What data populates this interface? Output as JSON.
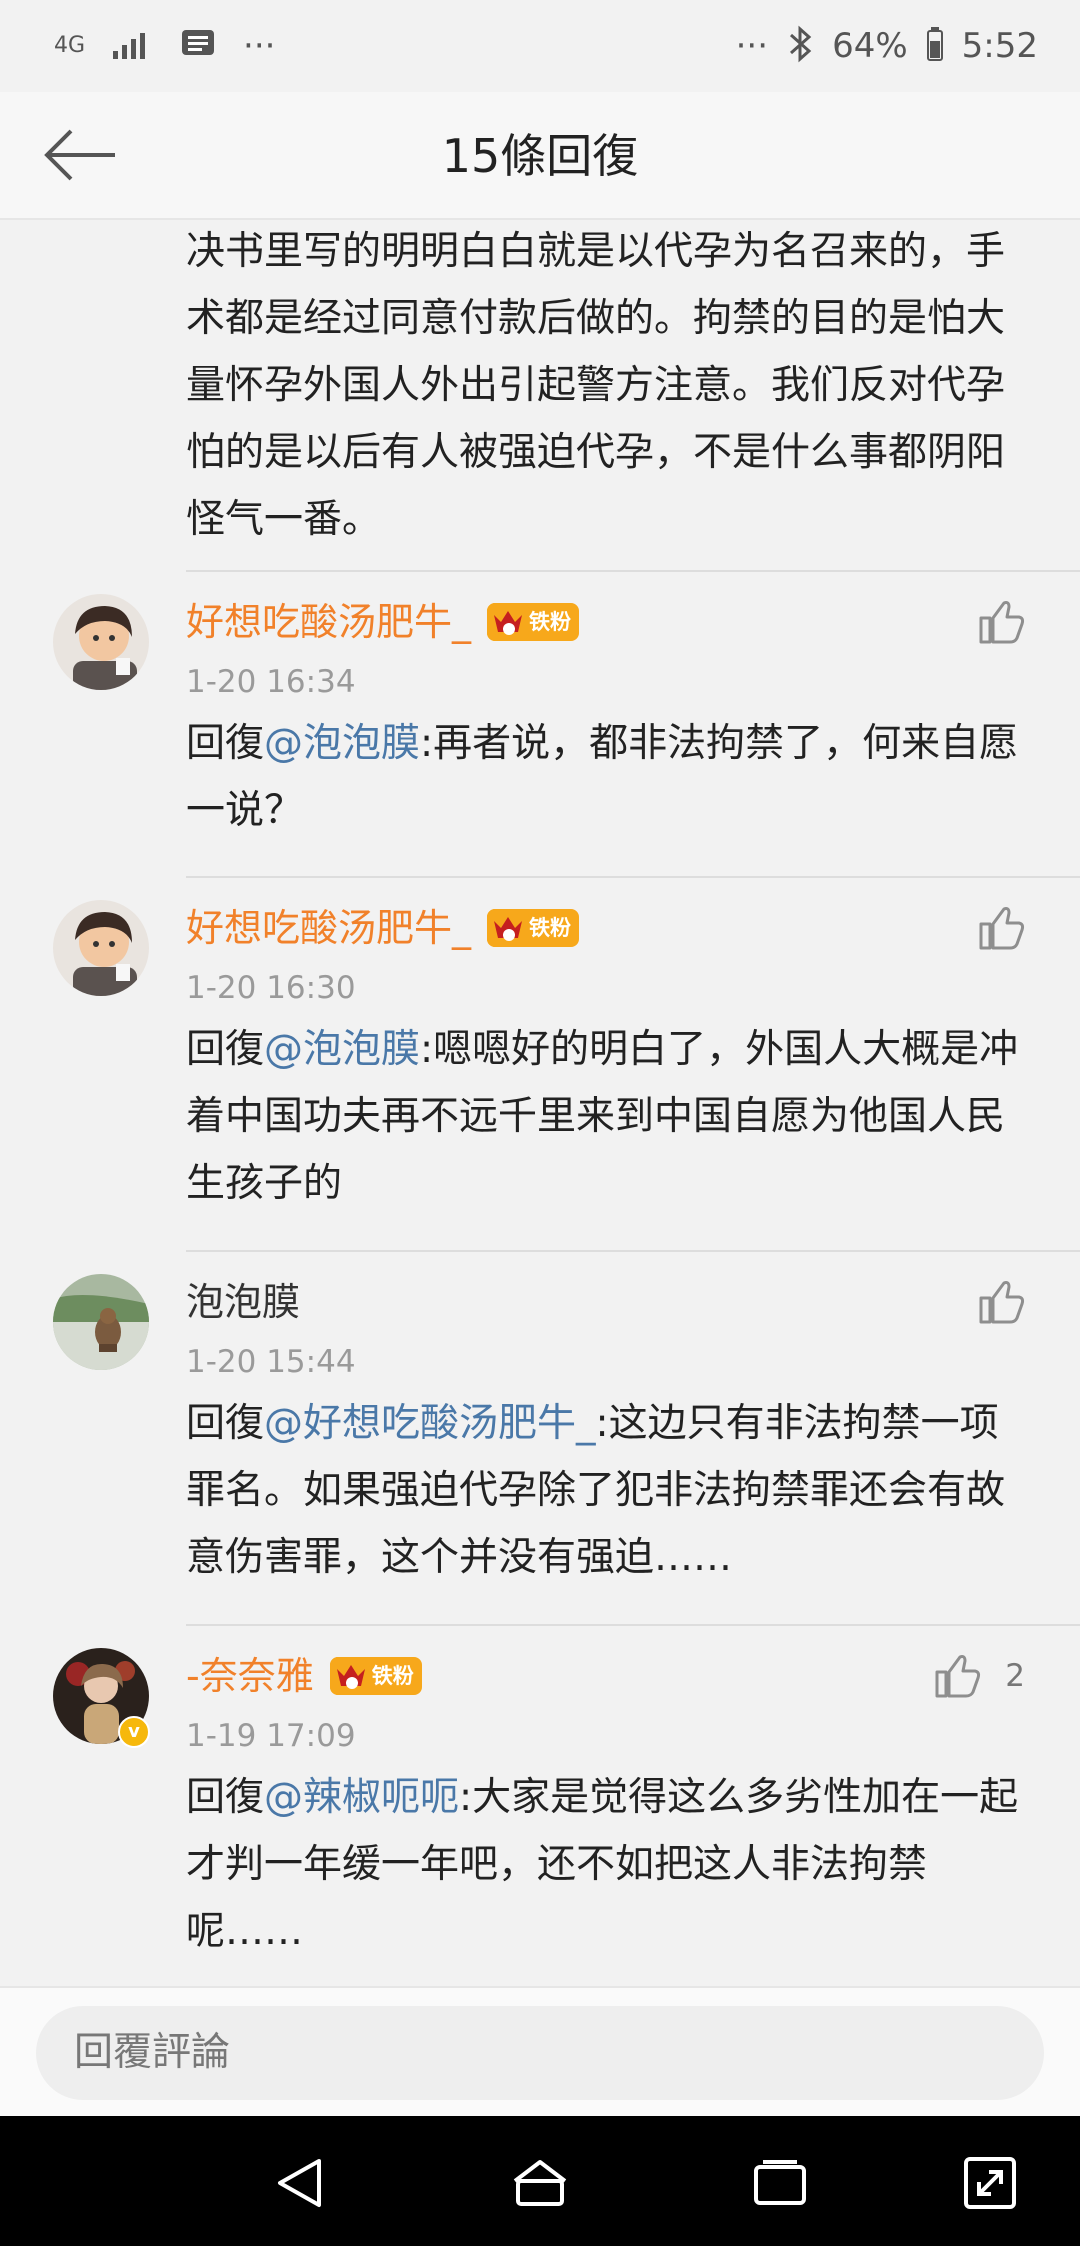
{
  "status_bar": {
    "network": "4G",
    "dots_left": "···",
    "dots_right": "···",
    "battery": "64%",
    "time": "5:52"
  },
  "header": {
    "title": "15條回復"
  },
  "top_comment": {
    "text": "决书里写的明明白白就是以代孕为名召来的，手术都是经过同意付款后做的。拘禁的目的是怕大量怀孕外国人外出引起警方注意。我们反对代孕怕的是以后有人被强迫代孕，不是什么事都阴阳怪气一番。"
  },
  "comments": [
    {
      "username": "好想吃酸汤肥牛_",
      "badge": "铁粉",
      "time": "1-20 16:34",
      "reply_prefix": "回復",
      "mention": "@泡泡膜",
      "text": ":再者说，都非法拘禁了，何来自愿一说？",
      "likes": ""
    },
    {
      "username": "好想吃酸汤肥牛_",
      "badge": "铁粉",
      "time": "1-20 16:30",
      "reply_prefix": "回復",
      "mention": "@泡泡膜",
      "text": ":嗯嗯好的明白了，外国人大概是冲着中国功夫再不远千里来到中国自愿为他国人民生孩子的",
      "likes": ""
    },
    {
      "username": "泡泡膜",
      "badge": "",
      "time": "1-20 15:44",
      "reply_prefix": "回復",
      "mention": "@好想吃酸汤肥牛_",
      "text": ":这边只有非法拘禁一项罪名。如果强迫代孕除了犯非法拘禁罪还会有故意伤害罪，这个并没有强迫……",
      "likes": ""
    },
    {
      "username": "-奈奈雅",
      "badge": "铁粉",
      "time": "1-19 17:09",
      "reply_prefix": "回復",
      "mention": "@辣椒呃呃",
      "text": ":大家是觉得这么多劣性加在一起才判一年缓一年吧，还不如把这人非法拘禁呢……",
      "likes": "2"
    }
  ],
  "reply_bar": {
    "placeholder": "回覆評論"
  },
  "colors": {
    "username_orange": "#f1812a",
    "username_plain": "#333333",
    "mention_blue": "#4a78a8",
    "badge_orange": "#f7a81b"
  }
}
